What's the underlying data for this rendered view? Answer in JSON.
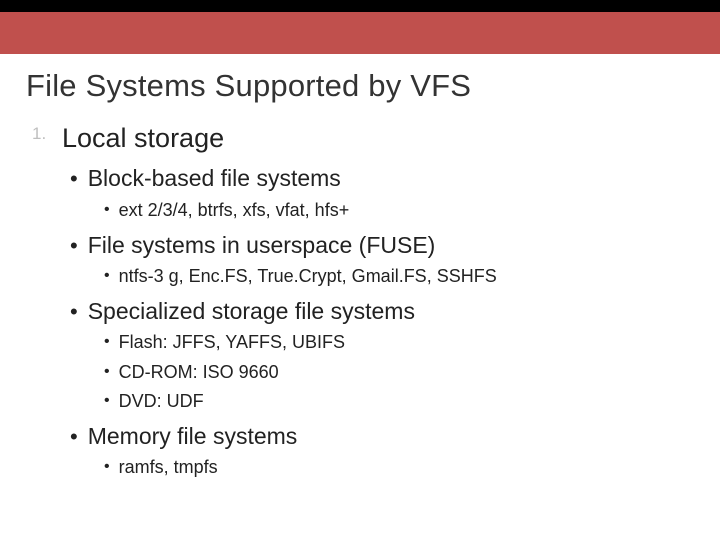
{
  "title": "File Systems Supported by VFS",
  "list_number": "1.",
  "h1": "Local storage",
  "sec1": {
    "h": "Block-based file systems",
    "b1": "ext 2/3/4, btrfs, xfs, vfat, hfs+"
  },
  "sec2": {
    "h": "File systems in userspace (FUSE)",
    "b1": "ntfs-3 g, Enc.FS, True.Crypt, Gmail.FS, SSHFS"
  },
  "sec3": {
    "h": "Specialized storage file systems",
    "b1": "Flash: JFFS, YAFFS, UBIFS",
    "b2": "CD-ROM: ISO 9660",
    "b3": "DVD: UDF"
  },
  "sec4": {
    "h": "Memory file systems",
    "b1": "ramfs, tmpfs"
  }
}
